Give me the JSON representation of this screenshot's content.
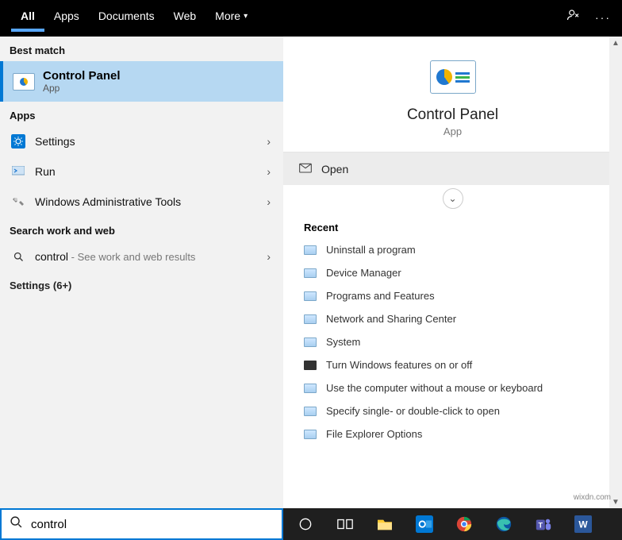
{
  "tabs": {
    "all": "All",
    "apps": "Apps",
    "documents": "Documents",
    "web": "Web",
    "more": "More"
  },
  "sections": {
    "best_match": "Best match",
    "apps": "Apps",
    "search_web": "Search work and web",
    "settings_more": "Settings (6+)"
  },
  "best_match": {
    "title": "Control Panel",
    "subtitle": "App"
  },
  "apps_list": [
    {
      "label": "Settings",
      "icon": "gear"
    },
    {
      "label": "Run",
      "icon": "run"
    },
    {
      "label": "Windows Administrative Tools",
      "icon": "admin"
    }
  ],
  "web_search": {
    "query": "control",
    "hint": " - See work and web results"
  },
  "preview": {
    "title": "Control Panel",
    "subtitle": "App",
    "open": "Open"
  },
  "recent": {
    "label": "Recent",
    "items": [
      "Uninstall a program",
      "Device Manager",
      "Programs and Features",
      "Network and Sharing Center",
      "System",
      "Turn Windows features on or off",
      "Use the computer without a mouse or keyboard",
      "Specify single- or double-click to open",
      "File Explorer Options"
    ]
  },
  "search_input": {
    "value": "control"
  },
  "watermark": "wixdn.com"
}
